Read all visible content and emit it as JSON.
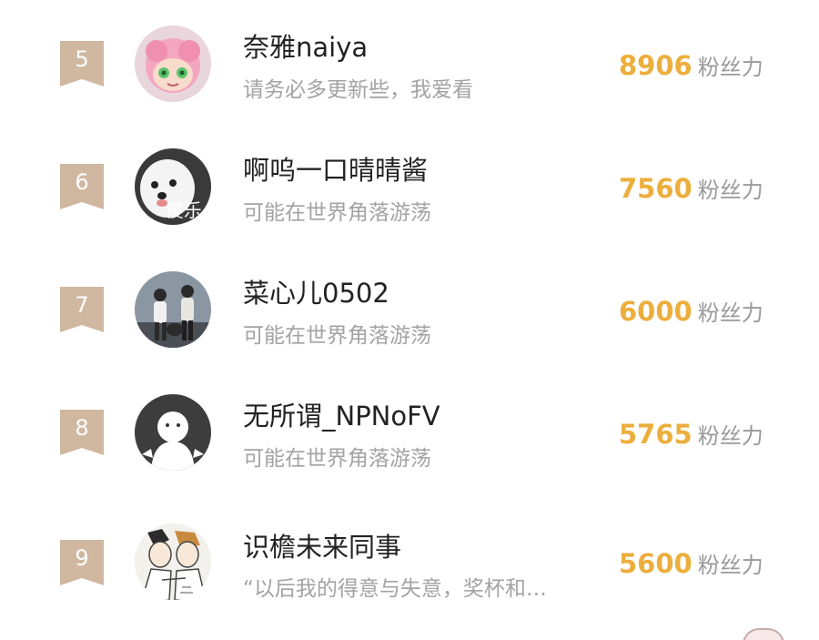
{
  "ranking": [
    {
      "rank": "5",
      "name": "奈雅naiya",
      "signature": "请务必多更新些，我爱看",
      "fans": "8906",
      "fans_label": "粉丝力",
      "avatar_icon": "pink-hair-anime-avatar-icon"
    },
    {
      "rank": "6",
      "name": "啊呜一口晴晴酱",
      "signature": "可能在世界角落游荡",
      "fans": "7560",
      "fans_label": "粉丝力",
      "avatar_icon": "white-dog-avatar-icon",
      "avatar_text": "傻乐"
    },
    {
      "rank": "7",
      "name": "菜心儿0502",
      "signature": "可能在世界角落游荡",
      "fans": "6000",
      "fans_label": "粉丝力",
      "avatar_icon": "two-people-photo-avatar-icon"
    },
    {
      "rank": "8",
      "name": "无所谓_NPNoFV",
      "signature": "可能在世界角落游荡",
      "fans": "5765",
      "fans_label": "粉丝力",
      "avatar_icon": "default-ghost-avatar-icon"
    },
    {
      "rank": "9",
      "name": "识檐未来同事",
      "signature": "“以后我的得意与失意，奖杯和…",
      "fans": "5600",
      "fans_label": "粉丝力",
      "avatar_icon": "manga-characters-avatar-icon"
    }
  ],
  "colors": {
    "badge": "#cfb7a0",
    "fans_number": "#ecae3c",
    "name": "#222222",
    "signature": "#a3a3a3"
  }
}
